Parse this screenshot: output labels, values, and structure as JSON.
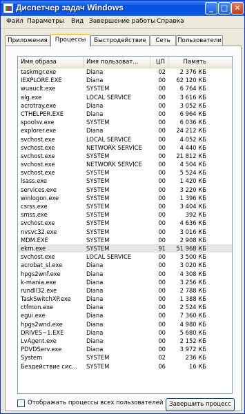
{
  "window": {
    "title": "Диспетчер задач Windows"
  },
  "titlebar": {
    "minimize_label": "_",
    "maximize_label": "□",
    "close_label": "✕"
  },
  "menu": [
    "Файл",
    "Параметры",
    "Вид",
    "Завершение работы",
    "Справка"
  ],
  "tabs": [
    "Приложения",
    "Процессы",
    "Быстродействие",
    "Сеть",
    "Пользователи"
  ],
  "active_tab": "Процессы",
  "columns": [
    "Имя образа",
    "Имя пользоват...",
    "ЦП",
    "Память"
  ],
  "processes": [
    {
      "name": "taskmgr.exe",
      "user": "Diana",
      "cpu": "02",
      "mem": "2 376 КБ"
    },
    {
      "name": "IEXPLORE.EXE",
      "user": "Diana",
      "cpu": "00",
      "mem": "62 120 КБ"
    },
    {
      "name": "wuauclt.exe",
      "user": "SYSTEM",
      "cpu": "00",
      "mem": "6 764 КБ"
    },
    {
      "name": "alg.exe",
      "user": "LOCAL SERVICE",
      "cpu": "00",
      "mem": "3 616 КБ"
    },
    {
      "name": "acrotray.exe",
      "user": "Diana",
      "cpu": "00",
      "mem": "3 052 КБ"
    },
    {
      "name": "CTHELPER.EXE",
      "user": "Diana",
      "cpu": "00",
      "mem": "6 964 КБ"
    },
    {
      "name": "spoolsv.exe",
      "user": "SYSTEM",
      "cpu": "00",
      "mem": "6 036 КБ"
    },
    {
      "name": "explorer.exe",
      "user": "Diana",
      "cpu": "00",
      "mem": "24 212 КБ"
    },
    {
      "name": "svchost.exe",
      "user": "LOCAL SERVICE",
      "cpu": "00",
      "mem": "4 052 КБ"
    },
    {
      "name": "svchost.exe",
      "user": "NETWORK SERVICE",
      "cpu": "00",
      "mem": "4 440 КБ"
    },
    {
      "name": "svchost.exe",
      "user": "SYSTEM",
      "cpu": "00",
      "mem": "21 812 КБ"
    },
    {
      "name": "svchost.exe",
      "user": "NETWORK SERVICE",
      "cpu": "00",
      "mem": "4 504 КБ"
    },
    {
      "name": "svchost.exe",
      "user": "SYSTEM",
      "cpu": "00",
      "mem": "5 524 КБ"
    },
    {
      "name": "lsass.exe",
      "user": "SYSTEM",
      "cpu": "00",
      "mem": "1 420 КБ"
    },
    {
      "name": "services.exe",
      "user": "SYSTEM",
      "cpu": "00",
      "mem": "3 220 КБ"
    },
    {
      "name": "winlogon.exe",
      "user": "SYSTEM",
      "cpu": "00",
      "mem": "1 396 КБ"
    },
    {
      "name": "csrss.exe",
      "user": "SYSTEM",
      "cpu": "00",
      "mem": "3 404 КБ"
    },
    {
      "name": "smss.exe",
      "user": "SYSTEM",
      "cpu": "00",
      "mem": "392 КБ"
    },
    {
      "name": "svchost.exe",
      "user": "SYSTEM",
      "cpu": "00",
      "mem": "4 636 КБ"
    },
    {
      "name": "nvsvc32.exe",
      "user": "SYSTEM",
      "cpu": "00",
      "mem": "3 016 КБ"
    },
    {
      "name": "MDM.EXE",
      "user": "SYSTEM",
      "cpu": "00",
      "mem": "2 908 КБ"
    },
    {
      "name": "ekrn.exe",
      "user": "SYSTEM",
      "cpu": "91",
      "mem": "51 968 КБ"
    },
    {
      "name": "svchost.exe",
      "user": "LOCAL SERVICE",
      "cpu": "00",
      "mem": "3 500 КБ"
    },
    {
      "name": "acrobat_sl.exe",
      "user": "Diana",
      "cpu": "00",
      "mem": "3 020 КБ"
    },
    {
      "name": "hpgs2wnf.exe",
      "user": "Diana",
      "cpu": "00",
      "mem": "4 308 КБ"
    },
    {
      "name": "k-mania.exe",
      "user": "Diana",
      "cpu": "00",
      "mem": "3 256 КБ"
    },
    {
      "name": "rundll32.exe",
      "user": "Diana",
      "cpu": "00",
      "mem": "2 788 КБ"
    },
    {
      "name": "TaskSwitchXP.exe",
      "user": "Diana",
      "cpu": "00",
      "mem": "1 388 КБ"
    },
    {
      "name": "ctfmon.exe",
      "user": "Diana",
      "cpu": "00",
      "mem": "2 524 КБ"
    },
    {
      "name": "egui.exe",
      "user": "Diana",
      "cpu": "00",
      "mem": "7 360 КБ"
    },
    {
      "name": "hpgs2wnd.exe",
      "user": "Diana",
      "cpu": "00",
      "mem": "4 980 КБ"
    },
    {
      "name": "DRIVES~1.EXE",
      "user": "Diana",
      "cpu": "00",
      "mem": "5 680 КБ"
    },
    {
      "name": "LvAgent.exe",
      "user": "Diana",
      "cpu": "00",
      "mem": "2 152 КБ"
    },
    {
      "name": "PDVDServ.exe",
      "user": "Diana",
      "cpu": "00",
      "mem": "3 972 КБ"
    },
    {
      "name": "System",
      "user": "SYSTEM",
      "cpu": "02",
      "mem": "236 КБ"
    },
    {
      "name": "Бездействие сис...",
      "user": "SYSTEM",
      "cpu": "06",
      "mem": "16 КБ"
    }
  ],
  "selected_row": 21,
  "footer": {
    "show_all_label": "Отображать процессы всех пользователей",
    "end_process_label": "Завершить процесс"
  }
}
